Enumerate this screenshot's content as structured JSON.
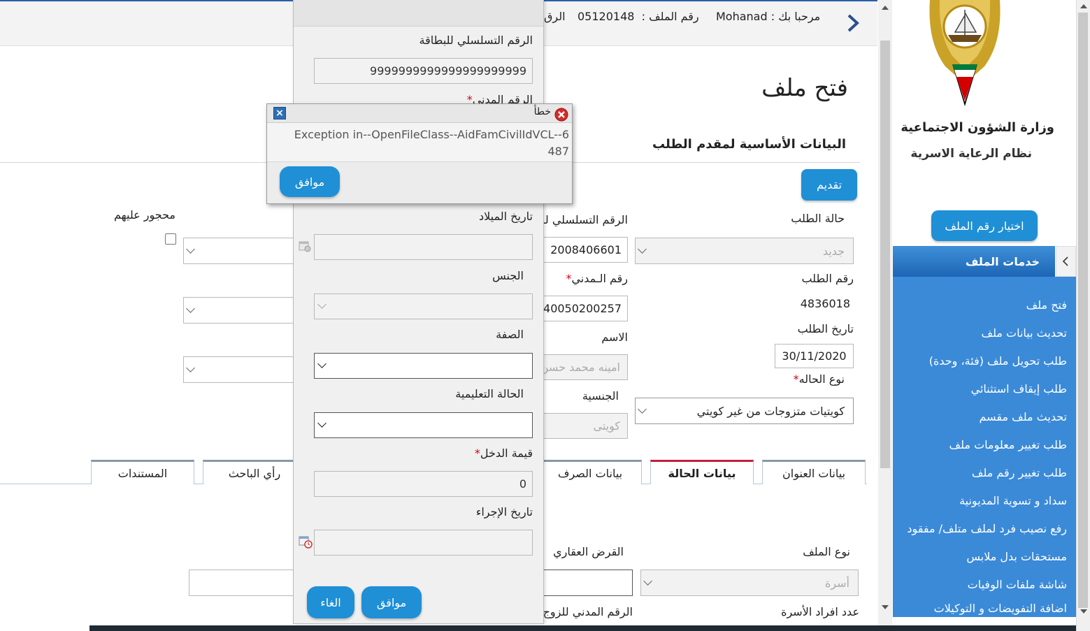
{
  "header": {
    "welcome_label": "مرحبا بك :",
    "user_name": "Mohanad",
    "file_no_label": "رقم الملف :",
    "file_no_value": "05120148",
    "cut_text": "الرق"
  },
  "sidebar": {
    "ministry": "وزارة الشؤون الاجتماعية",
    "system": "نظام الرعاية الاسرية",
    "choose_file_button": "اختيار رقم الملف",
    "services_header": "خدمات الملف",
    "items": [
      {
        "label": "فتح ملف"
      },
      {
        "label": "تحديث بيانات ملف"
      },
      {
        "label": "طلب تحويل ملف (فئة، وحدة)"
      },
      {
        "label": "طلب إيقاف استثنائي"
      },
      {
        "label": "تحديث ملف مقسم"
      },
      {
        "label": "طلب تغيير معلومات ملف"
      },
      {
        "label": "طلب تغيير رقم ملف"
      },
      {
        "label": "سداد و تسوية المديونية"
      },
      {
        "label": "رفع نصيب فرد لملف متلف/ مفقود"
      },
      {
        "label": "مستحقات بدل ملابس"
      },
      {
        "label": "شاشة ملفات الوفيات"
      },
      {
        "label": "اضافة التفويضات و التوكيلات"
      }
    ]
  },
  "page": {
    "title": "فتح ملف",
    "section_title": "البيانات الأساسية لمقدم الطلب",
    "submit_button": "تقديم"
  },
  "form": {
    "request_status_label": "حالة الطلب",
    "request_status_value": "جديد",
    "request_no_label": "رقم الطلب",
    "request_no_value": "4836018",
    "request_date_label": "تاريخ الطلب",
    "request_date_value": "30/11/2020",
    "case_type_label": "نوع الحاله",
    "case_type_value": "كويتيات متزوجات من غير كويتي",
    "serial_label": "الرقم التسلسلي للبطاقة",
    "serial_value": "2008406601",
    "civil_id_label": "رقم الـمدني",
    "civil_id_value": "40050200257",
    "name_label": "الاسم",
    "name_value": "امينه محمد حسن",
    "nationality_label": "الجنسية",
    "nationality_value": "كويتى",
    "interdicted_label": "محجور عليهم"
  },
  "tabs": [
    {
      "label": "بيانات العنوان"
    },
    {
      "label": "بيانات الحالة"
    },
    {
      "label": "بيانات الصرف"
    },
    {
      "label": "رأي الباحث"
    },
    {
      "label": "المستندات"
    }
  ],
  "lower": {
    "file_type_label": "نوع الملف",
    "file_type_value": "أسرة",
    "loan_label": "القرض العقاري",
    "family_count_label": "عدد افراد الأسرة",
    "spouse_civil_label": "الرقم المدني للزوج"
  },
  "panel": {
    "serial_label": "الرقم التسلسلي للبطاقة",
    "serial_value": "9999999999999999999999",
    "civil_label": "الرقم المدني",
    "birth_label": "تاريخ الميلاد",
    "gender_label": "الجنس",
    "relation_label": "الصفة",
    "education_label": "الحالة التعليمية",
    "income_label": "قيمة الدخل",
    "income_value": "0",
    "proc_date_label": "تاريخ الإجراء",
    "ok_button": "موافق",
    "cancel_button": "الغاء"
  },
  "dialog": {
    "title": "خطأ",
    "message": "Exception in--OpenFileClass--AidFamCivilIdVCL--6487",
    "ok_button": "موافق"
  }
}
